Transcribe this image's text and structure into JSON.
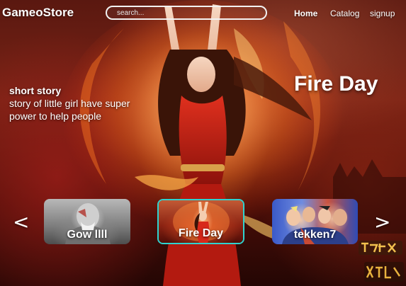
{
  "header": {
    "brand": "GameoStore",
    "search": {
      "placeholder": "search...",
      "value": ""
    },
    "nav": [
      {
        "label": "Home",
        "active": true
      },
      {
        "label": "Catalog",
        "active": false
      },
      {
        "label": "signup",
        "active": false
      }
    ]
  },
  "hero": {
    "title": "Fire Day",
    "story_title": "short story",
    "story_body": "story of little girl have super power to help people"
  },
  "carousel": {
    "prev_icon": "<",
    "next_icon": ">",
    "selected_index": 1,
    "items": [
      {
        "label": "Gow llll",
        "icon": "gow-thumbnail"
      },
      {
        "label": "Fire Day",
        "icon": "fire-day-thumbnail"
      },
      {
        "label": "tekken7",
        "icon": "tekken7-thumbnail"
      }
    ]
  },
  "colors": {
    "accent_border": "#2fd3cf",
    "text": "#ffffff"
  }
}
